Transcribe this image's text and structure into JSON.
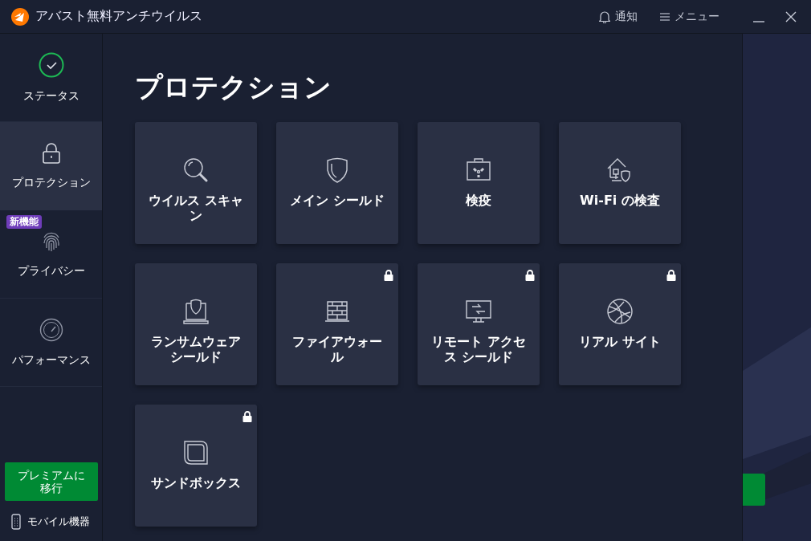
{
  "window": {
    "title": "アバスト無料アンチウイルス",
    "actions": [
      {
        "label": "通知"
      },
      {
        "label": "メニュー"
      }
    ]
  },
  "sidebar": {
    "items": [
      {
        "label": "ステータス",
        "selected": false
      },
      {
        "label": "プロテクション",
        "selected": true
      },
      {
        "label": "プライバシー",
        "selected": false,
        "badge": "新機能"
      },
      {
        "label": "パフォーマンス",
        "selected": false
      }
    ],
    "upgrade_button": "プレミアムに移行",
    "mobile": "モバイル機器"
  },
  "page": {
    "title": "プロテクション",
    "cards": [
      {
        "label": "ウイルス スキャン",
        "locked": false
      },
      {
        "label": "メイン シールド",
        "locked": false
      },
      {
        "label": "検疫",
        "locked": false
      },
      {
        "label": "Wi-Fi の検査",
        "locked": false
      },
      {
        "label": "ランサムウェアシールド",
        "locked": false
      },
      {
        "label": "ファイアウォール",
        "locked": true
      },
      {
        "label": "リモート アクセス シールド",
        "locked": true
      },
      {
        "label": "リアル サイト",
        "locked": true
      },
      {
        "label": "サンドボックス",
        "locked": true
      }
    ]
  }
}
